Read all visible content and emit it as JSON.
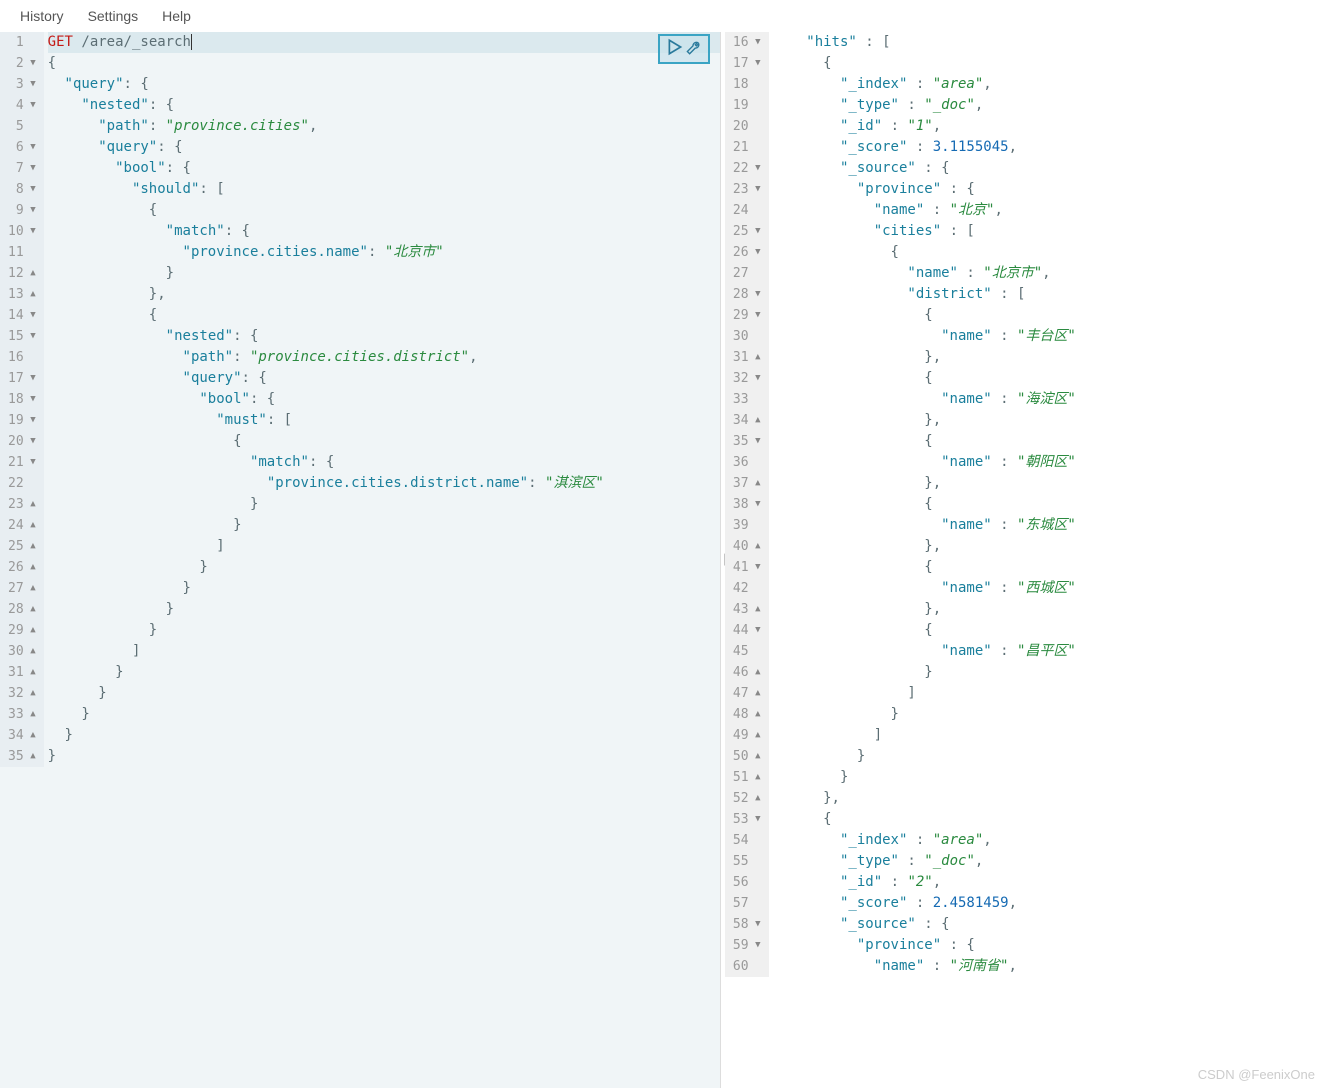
{
  "menu": {
    "history": "History",
    "settings": "Settings",
    "help": "Help"
  },
  "watermark": "CSDN @FeenixOne",
  "left": {
    "start": 1,
    "lines": [
      {
        "n": 1,
        "f": "",
        "segs": [
          [
            "method",
            "GET"
          ],
          [
            "pun",
            " "
          ],
          [
            "path",
            "/area/_search"
          ]
        ],
        "first": true
      },
      {
        "n": 2,
        "f": "▾",
        "segs": [
          [
            "pun",
            "{"
          ]
        ]
      },
      {
        "n": 3,
        "f": "▾",
        "segs": [
          [
            "pun",
            "  "
          ],
          [
            "key",
            "\"query\""
          ],
          [
            "pun",
            ": {"
          ]
        ]
      },
      {
        "n": 4,
        "f": "▾",
        "segs": [
          [
            "pun",
            "    "
          ],
          [
            "key",
            "\"nested\""
          ],
          [
            "pun",
            ": {"
          ]
        ]
      },
      {
        "n": 5,
        "f": "",
        "segs": [
          [
            "pun",
            "      "
          ],
          [
            "key",
            "\"path\""
          ],
          [
            "pun",
            ": "
          ],
          [
            "val",
            "\"province.cities\""
          ],
          [
            "pun",
            ","
          ]
        ]
      },
      {
        "n": 6,
        "f": "▾",
        "segs": [
          [
            "pun",
            "      "
          ],
          [
            "key",
            "\"query\""
          ],
          [
            "pun",
            ": {"
          ]
        ]
      },
      {
        "n": 7,
        "f": "▾",
        "segs": [
          [
            "pun",
            "        "
          ],
          [
            "key",
            "\"bool\""
          ],
          [
            "pun",
            ": {"
          ]
        ]
      },
      {
        "n": 8,
        "f": "▾",
        "segs": [
          [
            "pun",
            "          "
          ],
          [
            "key",
            "\"should\""
          ],
          [
            "pun",
            ": ["
          ]
        ]
      },
      {
        "n": 9,
        "f": "▾",
        "segs": [
          [
            "pun",
            "            {"
          ]
        ]
      },
      {
        "n": 10,
        "f": "▾",
        "segs": [
          [
            "pun",
            "              "
          ],
          [
            "key",
            "\"match\""
          ],
          [
            "pun",
            ": {"
          ]
        ]
      },
      {
        "n": 11,
        "f": "",
        "segs": [
          [
            "pun",
            "                "
          ],
          [
            "key",
            "\"province.cities.name\""
          ],
          [
            "pun",
            ": "
          ],
          [
            "val",
            "\"北京市\""
          ]
        ]
      },
      {
        "n": 12,
        "f": "▴",
        "segs": [
          [
            "pun",
            "              }"
          ]
        ]
      },
      {
        "n": 13,
        "f": "▴",
        "segs": [
          [
            "pun",
            "            },"
          ]
        ]
      },
      {
        "n": 14,
        "f": "▾",
        "segs": [
          [
            "pun",
            "            {"
          ]
        ]
      },
      {
        "n": 15,
        "f": "▾",
        "segs": [
          [
            "pun",
            "              "
          ],
          [
            "key",
            "\"nested\""
          ],
          [
            "pun",
            ": {"
          ]
        ]
      },
      {
        "n": 16,
        "f": "",
        "segs": [
          [
            "pun",
            "                "
          ],
          [
            "key",
            "\"path\""
          ],
          [
            "pun",
            ": "
          ],
          [
            "val",
            "\"province.cities.district\""
          ],
          [
            "pun",
            ","
          ]
        ]
      },
      {
        "n": 17,
        "f": "▾",
        "segs": [
          [
            "pun",
            "                "
          ],
          [
            "key",
            "\"query\""
          ],
          [
            "pun",
            ": {"
          ]
        ]
      },
      {
        "n": 18,
        "f": "▾",
        "segs": [
          [
            "pun",
            "                  "
          ],
          [
            "key",
            "\"bool\""
          ],
          [
            "pun",
            ": {"
          ]
        ]
      },
      {
        "n": 19,
        "f": "▾",
        "segs": [
          [
            "pun",
            "                    "
          ],
          [
            "key",
            "\"must\""
          ],
          [
            "pun",
            ": ["
          ]
        ]
      },
      {
        "n": 20,
        "f": "▾",
        "segs": [
          [
            "pun",
            "                      {"
          ]
        ]
      },
      {
        "n": 21,
        "f": "▾",
        "segs": [
          [
            "pun",
            "                        "
          ],
          [
            "key",
            "\"match\""
          ],
          [
            "pun",
            ": {"
          ]
        ]
      },
      {
        "n": 22,
        "f": "",
        "segs": [
          [
            "pun",
            "                          "
          ],
          [
            "key",
            "\"province.cities.district.name\""
          ],
          [
            "pun",
            ": "
          ],
          [
            "val",
            "\"淇滨区\""
          ]
        ]
      },
      {
        "n": 23,
        "f": "▴",
        "segs": [
          [
            "pun",
            "                        }"
          ]
        ]
      },
      {
        "n": 24,
        "f": "▴",
        "segs": [
          [
            "pun",
            "                      }"
          ]
        ]
      },
      {
        "n": 25,
        "f": "▴",
        "segs": [
          [
            "pun",
            "                    ]"
          ]
        ]
      },
      {
        "n": 26,
        "f": "▴",
        "segs": [
          [
            "pun",
            "                  }"
          ]
        ]
      },
      {
        "n": 27,
        "f": "▴",
        "segs": [
          [
            "pun",
            "                }"
          ]
        ]
      },
      {
        "n": 28,
        "f": "▴",
        "segs": [
          [
            "pun",
            "              }"
          ]
        ]
      },
      {
        "n": 29,
        "f": "▴",
        "segs": [
          [
            "pun",
            "            }"
          ]
        ]
      },
      {
        "n": 30,
        "f": "▴",
        "segs": [
          [
            "pun",
            "          ]"
          ]
        ]
      },
      {
        "n": 31,
        "f": "▴",
        "segs": [
          [
            "pun",
            "        }"
          ]
        ]
      },
      {
        "n": 32,
        "f": "▴",
        "segs": [
          [
            "pun",
            "      }"
          ]
        ]
      },
      {
        "n": 33,
        "f": "▴",
        "segs": [
          [
            "pun",
            "    }"
          ]
        ]
      },
      {
        "n": 34,
        "f": "▴",
        "segs": [
          [
            "pun",
            "  }"
          ]
        ]
      },
      {
        "n": 35,
        "f": "▴",
        "segs": [
          [
            "pun",
            "}"
          ]
        ]
      }
    ]
  },
  "right": {
    "start": 16,
    "lines": [
      {
        "n": 16,
        "f": "▾",
        "segs": [
          [
            "pun",
            "    "
          ],
          [
            "key",
            "\"hits\""
          ],
          [
            "pun",
            " : ["
          ]
        ]
      },
      {
        "n": 17,
        "f": "▾",
        "segs": [
          [
            "pun",
            "      {"
          ]
        ]
      },
      {
        "n": 18,
        "f": "",
        "segs": [
          [
            "pun",
            "        "
          ],
          [
            "key",
            "\"_index\""
          ],
          [
            "pun",
            " : "
          ],
          [
            "val",
            "\"area\""
          ],
          [
            "pun",
            ","
          ]
        ]
      },
      {
        "n": 19,
        "f": "",
        "segs": [
          [
            "pun",
            "        "
          ],
          [
            "key",
            "\"_type\""
          ],
          [
            "pun",
            " : "
          ],
          [
            "val",
            "\"_doc\""
          ],
          [
            "pun",
            ","
          ]
        ]
      },
      {
        "n": 20,
        "f": "",
        "segs": [
          [
            "pun",
            "        "
          ],
          [
            "key",
            "\"_id\""
          ],
          [
            "pun",
            " : "
          ],
          [
            "val",
            "\"1\""
          ],
          [
            "pun",
            ","
          ]
        ]
      },
      {
        "n": 21,
        "f": "",
        "segs": [
          [
            "pun",
            "        "
          ],
          [
            "key",
            "\"_score\""
          ],
          [
            "pun",
            " : "
          ],
          [
            "num",
            "3.1155045"
          ],
          [
            "pun",
            ","
          ]
        ]
      },
      {
        "n": 22,
        "f": "▾",
        "segs": [
          [
            "pun",
            "        "
          ],
          [
            "key",
            "\"_source\""
          ],
          [
            "pun",
            " : {"
          ]
        ]
      },
      {
        "n": 23,
        "f": "▾",
        "segs": [
          [
            "pun",
            "          "
          ],
          [
            "key",
            "\"province\""
          ],
          [
            "pun",
            " : {"
          ]
        ]
      },
      {
        "n": 24,
        "f": "",
        "segs": [
          [
            "pun",
            "            "
          ],
          [
            "key",
            "\"name\""
          ],
          [
            "pun",
            " : "
          ],
          [
            "val",
            "\"北京\""
          ],
          [
            "pun",
            ","
          ]
        ]
      },
      {
        "n": 25,
        "f": "▾",
        "segs": [
          [
            "pun",
            "            "
          ],
          [
            "key",
            "\"cities\""
          ],
          [
            "pun",
            " : ["
          ]
        ]
      },
      {
        "n": 26,
        "f": "▾",
        "segs": [
          [
            "pun",
            "              {"
          ]
        ]
      },
      {
        "n": 27,
        "f": "",
        "segs": [
          [
            "pun",
            "                "
          ],
          [
            "key",
            "\"name\""
          ],
          [
            "pun",
            " : "
          ],
          [
            "val",
            "\"北京市\""
          ],
          [
            "pun",
            ","
          ]
        ]
      },
      {
        "n": 28,
        "f": "▾",
        "segs": [
          [
            "pun",
            "                "
          ],
          [
            "key",
            "\"district\""
          ],
          [
            "pun",
            " : ["
          ]
        ]
      },
      {
        "n": 29,
        "f": "▾",
        "segs": [
          [
            "pun",
            "                  {"
          ]
        ]
      },
      {
        "n": 30,
        "f": "",
        "segs": [
          [
            "pun",
            "                    "
          ],
          [
            "key",
            "\"name\""
          ],
          [
            "pun",
            " : "
          ],
          [
            "val",
            "\"丰台区\""
          ]
        ]
      },
      {
        "n": 31,
        "f": "▴",
        "segs": [
          [
            "pun",
            "                  },"
          ]
        ]
      },
      {
        "n": 32,
        "f": "▾",
        "segs": [
          [
            "pun",
            "                  {"
          ]
        ]
      },
      {
        "n": 33,
        "f": "",
        "segs": [
          [
            "pun",
            "                    "
          ],
          [
            "key",
            "\"name\""
          ],
          [
            "pun",
            " : "
          ],
          [
            "val",
            "\"海淀区\""
          ]
        ]
      },
      {
        "n": 34,
        "f": "▴",
        "segs": [
          [
            "pun",
            "                  },"
          ]
        ]
      },
      {
        "n": 35,
        "f": "▾",
        "segs": [
          [
            "pun",
            "                  {"
          ]
        ]
      },
      {
        "n": 36,
        "f": "",
        "segs": [
          [
            "pun",
            "                    "
          ],
          [
            "key",
            "\"name\""
          ],
          [
            "pun",
            " : "
          ],
          [
            "val",
            "\"朝阳区\""
          ]
        ]
      },
      {
        "n": 37,
        "f": "▴",
        "segs": [
          [
            "pun",
            "                  },"
          ]
        ]
      },
      {
        "n": 38,
        "f": "▾",
        "segs": [
          [
            "pun",
            "                  {"
          ]
        ]
      },
      {
        "n": 39,
        "f": "",
        "segs": [
          [
            "pun",
            "                    "
          ],
          [
            "key",
            "\"name\""
          ],
          [
            "pun",
            " : "
          ],
          [
            "val",
            "\"东城区\""
          ]
        ]
      },
      {
        "n": 40,
        "f": "▴",
        "segs": [
          [
            "pun",
            "                  },"
          ]
        ]
      },
      {
        "n": 41,
        "f": "▾",
        "segs": [
          [
            "pun",
            "                  {"
          ]
        ]
      },
      {
        "n": 42,
        "f": "",
        "segs": [
          [
            "pun",
            "                    "
          ],
          [
            "key",
            "\"name\""
          ],
          [
            "pun",
            " : "
          ],
          [
            "val",
            "\"西城区\""
          ]
        ]
      },
      {
        "n": 43,
        "f": "▴",
        "segs": [
          [
            "pun",
            "                  },"
          ]
        ]
      },
      {
        "n": 44,
        "f": "▾",
        "segs": [
          [
            "pun",
            "                  {"
          ]
        ]
      },
      {
        "n": 45,
        "f": "",
        "segs": [
          [
            "pun",
            "                    "
          ],
          [
            "key",
            "\"name\""
          ],
          [
            "pun",
            " : "
          ],
          [
            "val",
            "\"昌平区\""
          ]
        ]
      },
      {
        "n": 46,
        "f": "▴",
        "segs": [
          [
            "pun",
            "                  }"
          ]
        ]
      },
      {
        "n": 47,
        "f": "▴",
        "segs": [
          [
            "pun",
            "                ]"
          ]
        ]
      },
      {
        "n": 48,
        "f": "▴",
        "segs": [
          [
            "pun",
            "              }"
          ]
        ]
      },
      {
        "n": 49,
        "f": "▴",
        "segs": [
          [
            "pun",
            "            ]"
          ]
        ]
      },
      {
        "n": 50,
        "f": "▴",
        "segs": [
          [
            "pun",
            "          }"
          ]
        ]
      },
      {
        "n": 51,
        "f": "▴",
        "segs": [
          [
            "pun",
            "        }"
          ]
        ]
      },
      {
        "n": 52,
        "f": "▴",
        "segs": [
          [
            "pun",
            "      },"
          ]
        ]
      },
      {
        "n": 53,
        "f": "▾",
        "segs": [
          [
            "pun",
            "      {"
          ]
        ]
      },
      {
        "n": 54,
        "f": "",
        "segs": [
          [
            "pun",
            "        "
          ],
          [
            "key",
            "\"_index\""
          ],
          [
            "pun",
            " : "
          ],
          [
            "val",
            "\"area\""
          ],
          [
            "pun",
            ","
          ]
        ]
      },
      {
        "n": 55,
        "f": "",
        "segs": [
          [
            "pun",
            "        "
          ],
          [
            "key",
            "\"_type\""
          ],
          [
            "pun",
            " : "
          ],
          [
            "val",
            "\"_doc\""
          ],
          [
            "pun",
            ","
          ]
        ]
      },
      {
        "n": 56,
        "f": "",
        "segs": [
          [
            "pun",
            "        "
          ],
          [
            "key",
            "\"_id\""
          ],
          [
            "pun",
            " : "
          ],
          [
            "val",
            "\"2\""
          ],
          [
            "pun",
            ","
          ]
        ]
      },
      {
        "n": 57,
        "f": "",
        "segs": [
          [
            "pun",
            "        "
          ],
          [
            "key",
            "\"_score\""
          ],
          [
            "pun",
            " : "
          ],
          [
            "num",
            "2.4581459"
          ],
          [
            "pun",
            ","
          ]
        ]
      },
      {
        "n": 58,
        "f": "▾",
        "segs": [
          [
            "pun",
            "        "
          ],
          [
            "key",
            "\"_source\""
          ],
          [
            "pun",
            " : {"
          ]
        ]
      },
      {
        "n": 59,
        "f": "▾",
        "segs": [
          [
            "pun",
            "          "
          ],
          [
            "key",
            "\"province\""
          ],
          [
            "pun",
            " : {"
          ]
        ]
      },
      {
        "n": 60,
        "f": "",
        "segs": [
          [
            "pun",
            "            "
          ],
          [
            "key",
            "\"name\""
          ],
          [
            "pun",
            " : "
          ],
          [
            "val",
            "\"河南省\""
          ],
          [
            "pun",
            ","
          ]
        ]
      }
    ]
  }
}
